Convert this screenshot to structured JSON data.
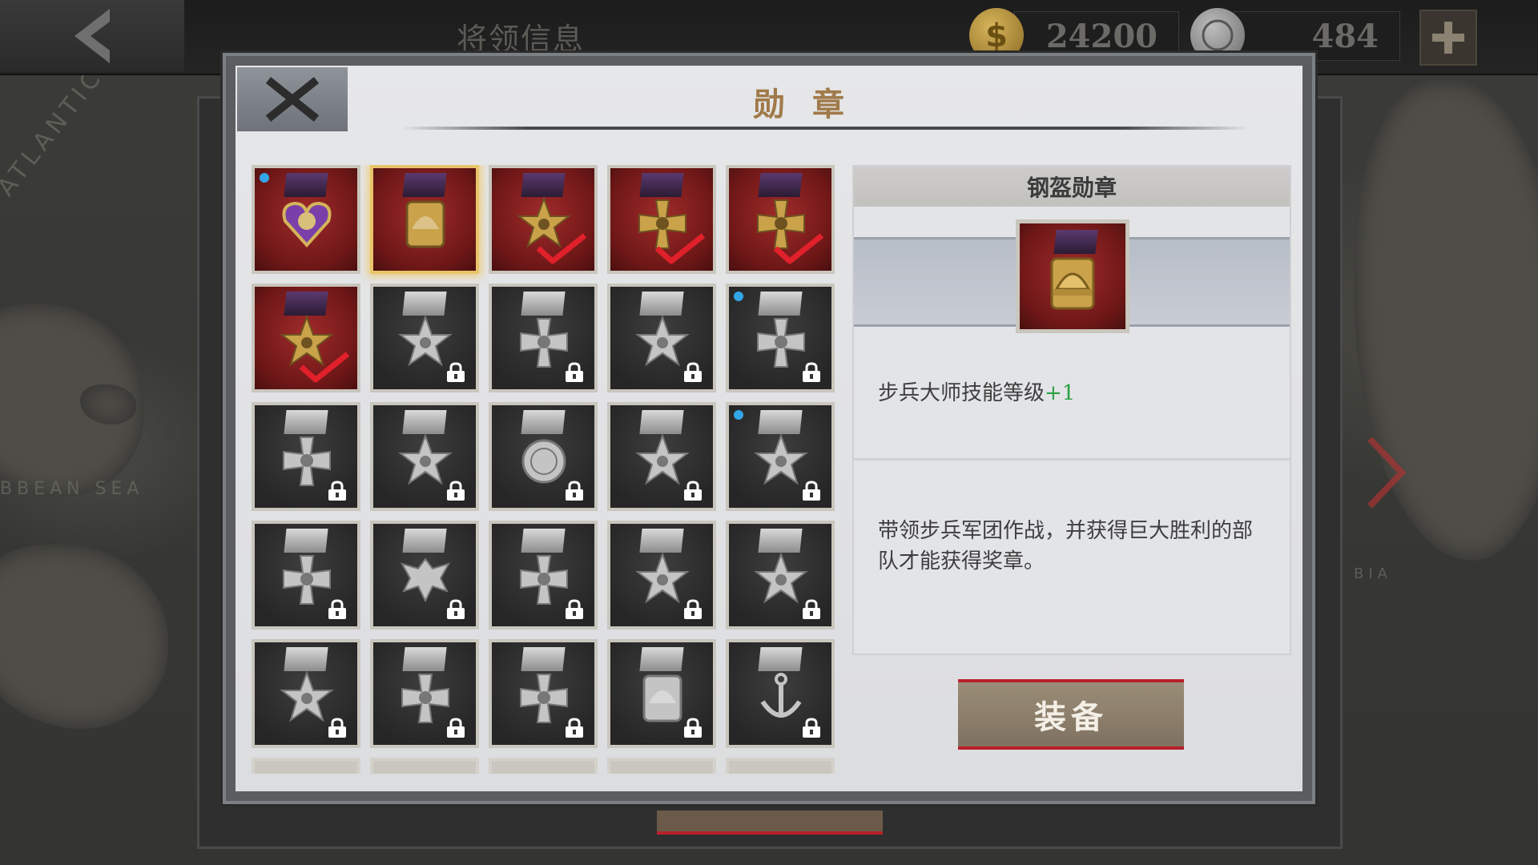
{
  "topbar": {
    "title": "将领信息",
    "gold": "24200",
    "medals_currency": "484",
    "back_icon": "chevron-left-icon",
    "plus_icon": "plus-icon"
  },
  "map": {
    "labels": [
      "ATLANTIC OCE",
      "BBEAN SEA",
      "BIA"
    ]
  },
  "modal": {
    "title": "勋章",
    "close_icon": "close-icon"
  },
  "medals": {
    "rows": [
      [
        {
          "state": "owned",
          "bg": "red",
          "dot": true,
          "icon": "purple-heart-medal-icon"
        },
        {
          "state": "selected",
          "bg": "red",
          "dot": false,
          "icon": "steel-helmet-medal-icon"
        },
        {
          "state": "equipped",
          "bg": "red",
          "dot": false,
          "icon": "star-medal-icon"
        },
        {
          "state": "equipped",
          "bg": "red",
          "dot": false,
          "icon": "cross-medal-icon"
        },
        {
          "state": "equipped",
          "bg": "red",
          "dot": false,
          "icon": "star-cross-medal-icon"
        }
      ],
      [
        {
          "state": "equipped",
          "bg": "red",
          "dot": false,
          "icon": "star-medal-icon"
        },
        {
          "state": "locked",
          "bg": "dark",
          "dot": false,
          "icon": "maltese-star-medal-icon"
        },
        {
          "state": "locked",
          "bg": "dark",
          "dot": false,
          "icon": "victoria-cross-medal-icon"
        },
        {
          "state": "locked",
          "bg": "dark",
          "dot": false,
          "icon": "order-star-medal-icon"
        },
        {
          "state": "locked",
          "bg": "dark",
          "dot": true,
          "icon": "eagle-cross-medal-icon"
        }
      ],
      [
        {
          "state": "locked",
          "bg": "dark",
          "dot": false,
          "icon": "cross-pattee-medal-icon"
        },
        {
          "state": "locked",
          "bg": "dark",
          "dot": false,
          "icon": "sunburst-star-medal-icon"
        },
        {
          "state": "locked",
          "bg": "dark",
          "dot": false,
          "icon": "round-medal-icon"
        },
        {
          "state": "locked",
          "bg": "dark",
          "dot": false,
          "icon": "five-point-star-medal-icon"
        },
        {
          "state": "locked",
          "bg": "dark",
          "dot": true,
          "icon": "sunburst-medal-icon"
        }
      ],
      [
        {
          "state": "locked",
          "bg": "dark",
          "dot": false,
          "icon": "iron-cross-medal-icon"
        },
        {
          "state": "locked",
          "bg": "dark",
          "dot": false,
          "icon": "eagle-medal-icon"
        },
        {
          "state": "locked",
          "bg": "dark",
          "dot": false,
          "icon": "crossed-swords-medal-icon"
        },
        {
          "state": "locked",
          "bg": "dark",
          "dot": false,
          "icon": "silver-star-medal-icon"
        },
        {
          "state": "locked",
          "bg": "dark",
          "dot": false,
          "icon": "swords-star-medal-icon"
        }
      ],
      [
        {
          "state": "locked",
          "bg": "dark",
          "dot": false,
          "icon": "rosette-star-medal-icon"
        },
        {
          "state": "locked",
          "bg": "dark",
          "dot": false,
          "icon": "flower-cross-medal-icon"
        },
        {
          "state": "locked",
          "bg": "dark",
          "dot": false,
          "icon": "swords-cross-medal-icon"
        },
        {
          "state": "locked",
          "bg": "dark",
          "dot": false,
          "icon": "shield-medal-icon"
        },
        {
          "state": "locked",
          "bg": "dark",
          "dot": false,
          "icon": "anchor-medal-icon"
        }
      ]
    ],
    "partial_row_count": 5
  },
  "detail": {
    "name": "钢盔勋章",
    "effect_text": "步兵大师技能等级",
    "effect_bonus": "+1",
    "description": "带领步兵军团作战，并获得巨大胜利的部队才能获得奖章。",
    "icon": "steel-helmet-medal-icon"
  },
  "actions": {
    "equip_label": "装备"
  },
  "colors": {
    "accent_red": "#b8202a",
    "title_gold": "#a07a4a",
    "bonus_green": "#2aa042",
    "selected_glow": "#e8c46a"
  }
}
